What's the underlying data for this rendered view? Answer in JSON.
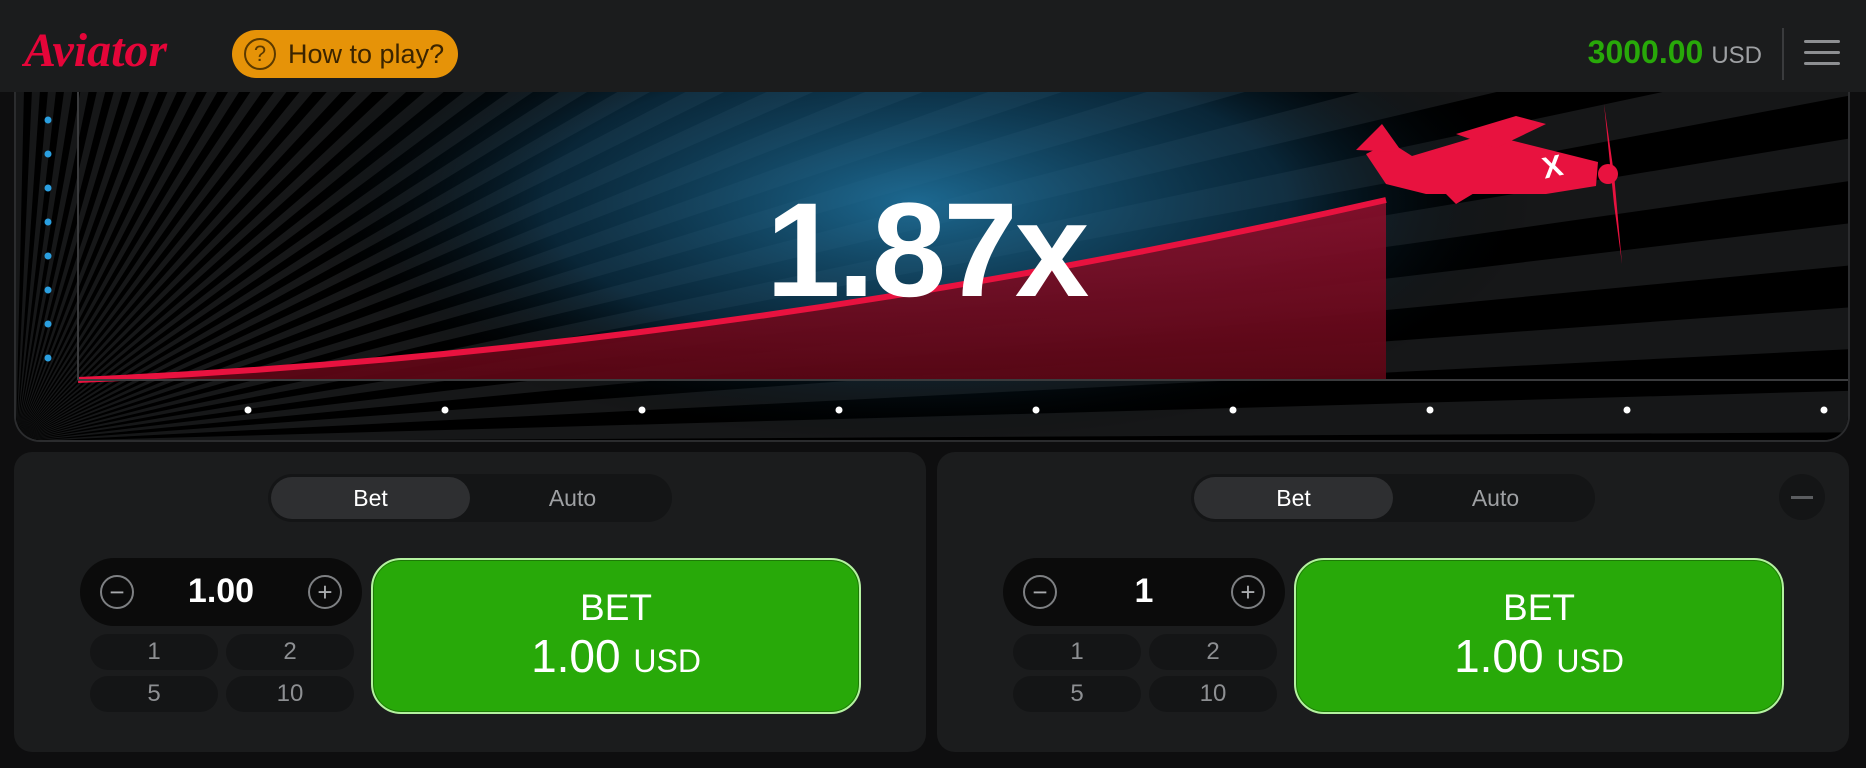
{
  "header": {
    "logo_text": "Aviator",
    "how_to_play": "How to play?",
    "balance_amount": "3000.00",
    "balance_currency": "USD"
  },
  "game": {
    "multiplier": "1.87x",
    "colors": {
      "curve": "#e8123f",
      "fill": "#7a0a1e",
      "glow": "#1e6e98",
      "plane": "#e8123f",
      "axis_dots_y": "#2a9fe0",
      "axis_dots_x": "#ffffff"
    }
  },
  "panels": [
    {
      "tabs": [
        "Bet",
        "Auto"
      ],
      "active_tab": "Bet",
      "amount": "1.00",
      "quick_amounts": [
        "1",
        "2",
        "5",
        "10"
      ],
      "bet_title": "BET",
      "bet_value": "1.00",
      "bet_currency": "USD"
    },
    {
      "tabs": [
        "Bet",
        "Auto"
      ],
      "active_tab": "Bet",
      "amount": "1",
      "quick_amounts": [
        "1",
        "2",
        "5",
        "10"
      ],
      "bet_title": "BET",
      "bet_value": "1.00",
      "bet_currency": "USD"
    }
  ]
}
